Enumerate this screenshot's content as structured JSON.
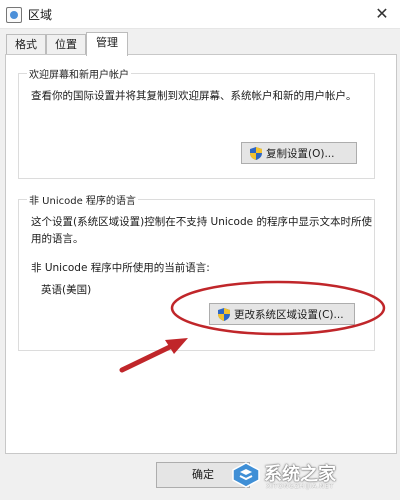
{
  "window": {
    "title": "区域",
    "close_glyph": "✕"
  },
  "tabs": [
    {
      "label": "格式",
      "active": false
    },
    {
      "label": "位置",
      "active": false
    },
    {
      "label": "管理",
      "active": true
    }
  ],
  "welcome_group": {
    "title": "欢迎屏幕和新用户帐户",
    "description": "查看你的国际设置并将其复制到欢迎屏幕、系统帐户和新的用户帐户。",
    "copy_button": "复制设置(O)..."
  },
  "unicode_group": {
    "title": "非 Unicode 程序的语言",
    "description_line1": "这个设置(系统区域设置)控制在不支持 Unicode 的程序中显示文本时所使",
    "description_line2": "用的语言。",
    "current_label": "非 Unicode 程序中所使用的当前语言:",
    "current_value": "英语(美国)",
    "change_button": "更改系统区域设置(C)..."
  },
  "footer": {
    "ok_button": "确定"
  },
  "watermark": {
    "text": "系统之家",
    "url": "XITONGZHIJIA.NET"
  },
  "colors": {
    "annotation_red": "#c0262a",
    "shield_blue": "#2e67c4",
    "shield_yellow": "#f2c230"
  },
  "icons": [
    "app-icon",
    "close-icon",
    "uac-shield-icon",
    "watermark-logo-icon"
  ]
}
